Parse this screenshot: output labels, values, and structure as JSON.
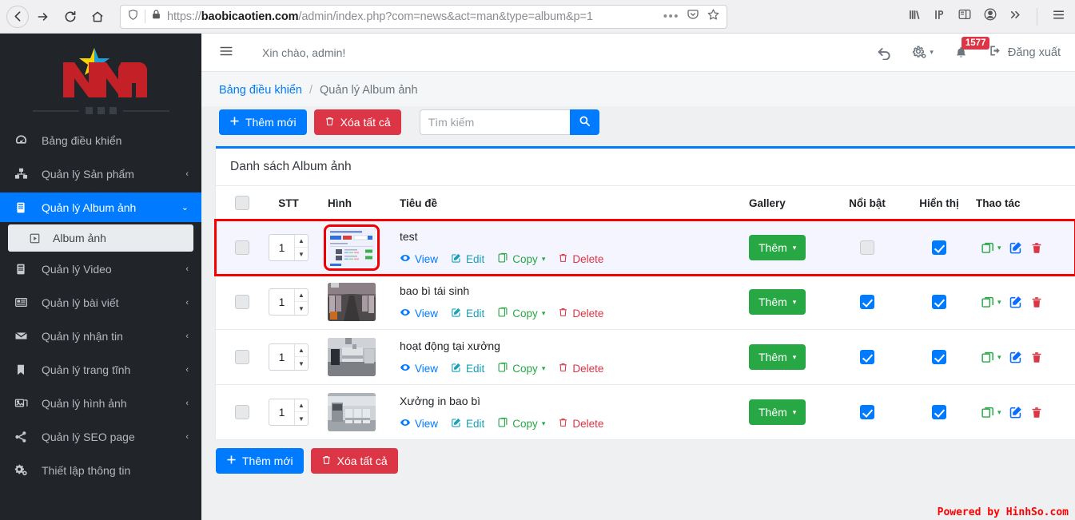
{
  "browser": {
    "url_prefix": "https://",
    "url_domain": "baobicaotien.com",
    "url_path": "/admin/index.php?com=news&act=man&type=album&p=1",
    "back_icon": "back-arrow-icon",
    "forward_icon": "forward-arrow-icon",
    "reload_icon": "reload-icon",
    "home_icon": "home-icon",
    "shield_icon": "shield-icon",
    "lock_icon": "padlock-icon",
    "more_icon": "ellipsis-icon",
    "pocket_icon": "pocket-icon",
    "bookmark_icon": "star-icon",
    "library_icon": "library-icon",
    "ip_icon": "ip-icon",
    "sidebar_icon": "sidebar-icon",
    "account_icon": "account-icon",
    "overflow_icon": "chevron-double-right-icon",
    "menu_icon": "hamburger-menu-icon"
  },
  "sidebar": {
    "logo_alt": "NNA",
    "items": [
      {
        "label": "Bảng điều khiển",
        "icon": "dashboard-icon",
        "caret": "",
        "state": "normal"
      },
      {
        "label": "Quản lý Sản phẩm",
        "icon": "boxes-icon",
        "caret": "‹",
        "state": "normal"
      },
      {
        "label": "Quản lý Album ảnh",
        "icon": "book-icon",
        "caret": "⌄",
        "state": "active"
      },
      {
        "label": "Album ảnh",
        "icon": "play-square-icon",
        "caret": "",
        "state": "sub"
      },
      {
        "label": "Quản lý Video",
        "icon": "book-icon",
        "caret": "‹",
        "state": "normal"
      },
      {
        "label": "Quản lý bài viết",
        "icon": "newspaper-icon",
        "caret": "‹",
        "state": "normal"
      },
      {
        "label": "Quản lý nhận tin",
        "icon": "envelope-icon",
        "caret": "‹",
        "state": "normal"
      },
      {
        "label": "Quản lý trang tĩnh",
        "icon": "bookmark-icon",
        "caret": "‹",
        "state": "normal"
      },
      {
        "label": "Quản lý hình ảnh",
        "icon": "images-icon",
        "caret": "‹",
        "state": "normal"
      },
      {
        "label": "Quản lý SEO page",
        "icon": "share-icon",
        "caret": "‹",
        "state": "normal"
      },
      {
        "label": "Thiết lập thông tin",
        "icon": "gears-icon",
        "caret": "",
        "state": "normal"
      }
    ]
  },
  "topnav": {
    "hamburger_icon": "hamburger-menu-icon",
    "greeting": "Xin chào, admin!",
    "undo_icon": "undo-arrow-icon",
    "settings_icon": "gears-icon",
    "settings_caret": "▾",
    "bell_icon": "bell-icon",
    "notification_count": "1577",
    "logout_icon": "logout-icon",
    "logout_label": "Đăng xuất"
  },
  "breadcrumb": {
    "home": "Bảng điều khiển",
    "separator": "/",
    "current": "Quản lý Album ảnh"
  },
  "toolbar": {
    "add_label": "Thêm mới",
    "add_icon": "plus-icon",
    "delete_all_label": "Xóa tất cả",
    "delete_all_icon": "trash-icon",
    "search_placeholder": "Tìm kiếm",
    "search_value": "",
    "search_icon": "search-icon"
  },
  "card": {
    "title": "Danh sách Album ảnh",
    "accent_color": "#007bff"
  },
  "table": {
    "headers": {
      "select": "",
      "stt": "STT",
      "image": "Hình",
      "title": "Tiêu đề",
      "gallery": "Gallery",
      "featured": "Nổi bật",
      "visible": "Hiển thị",
      "actions": "Thao tác"
    },
    "row_links": {
      "view": "View",
      "edit": "Edit",
      "copy": "Copy",
      "delete": "Delete",
      "view_icon": "eye-icon",
      "edit_icon": "pencil-square-icon",
      "copy_icon": "copy-icon",
      "delete_icon": "trash-icon",
      "copy_caret": "▾"
    },
    "gallery_button": {
      "label": "Thêm",
      "caret": "▾"
    },
    "action_icons": {
      "copy": "copy-stack-icon",
      "copy_caret": "▾",
      "edit": "edit-pencil-icon",
      "delete": "trash-red-icon"
    },
    "rows": [
      {
        "selected": false,
        "order": "1",
        "thumb_kind": "screenshot",
        "title": "test",
        "featured": false,
        "visible": true,
        "highlighted": true
      },
      {
        "selected": false,
        "order": "1",
        "thumb_kind": "photo-dark-aisle",
        "title": "bao bì tái sinh",
        "featured": true,
        "visible": true,
        "highlighted": false
      },
      {
        "selected": false,
        "order": "1",
        "thumb_kind": "photo-workshop",
        "title": "hoạt động tại xưởng",
        "featured": true,
        "visible": true,
        "highlighted": false
      },
      {
        "selected": false,
        "order": "1",
        "thumb_kind": "photo-printing",
        "title": "Xưởng in bao bì",
        "featured": true,
        "visible": true,
        "highlighted": false
      }
    ]
  },
  "footer": {
    "add_label": "Thêm mới",
    "delete_all_label": "Xóa tất cả",
    "powered_by": "Powered by HinhSo.com"
  }
}
